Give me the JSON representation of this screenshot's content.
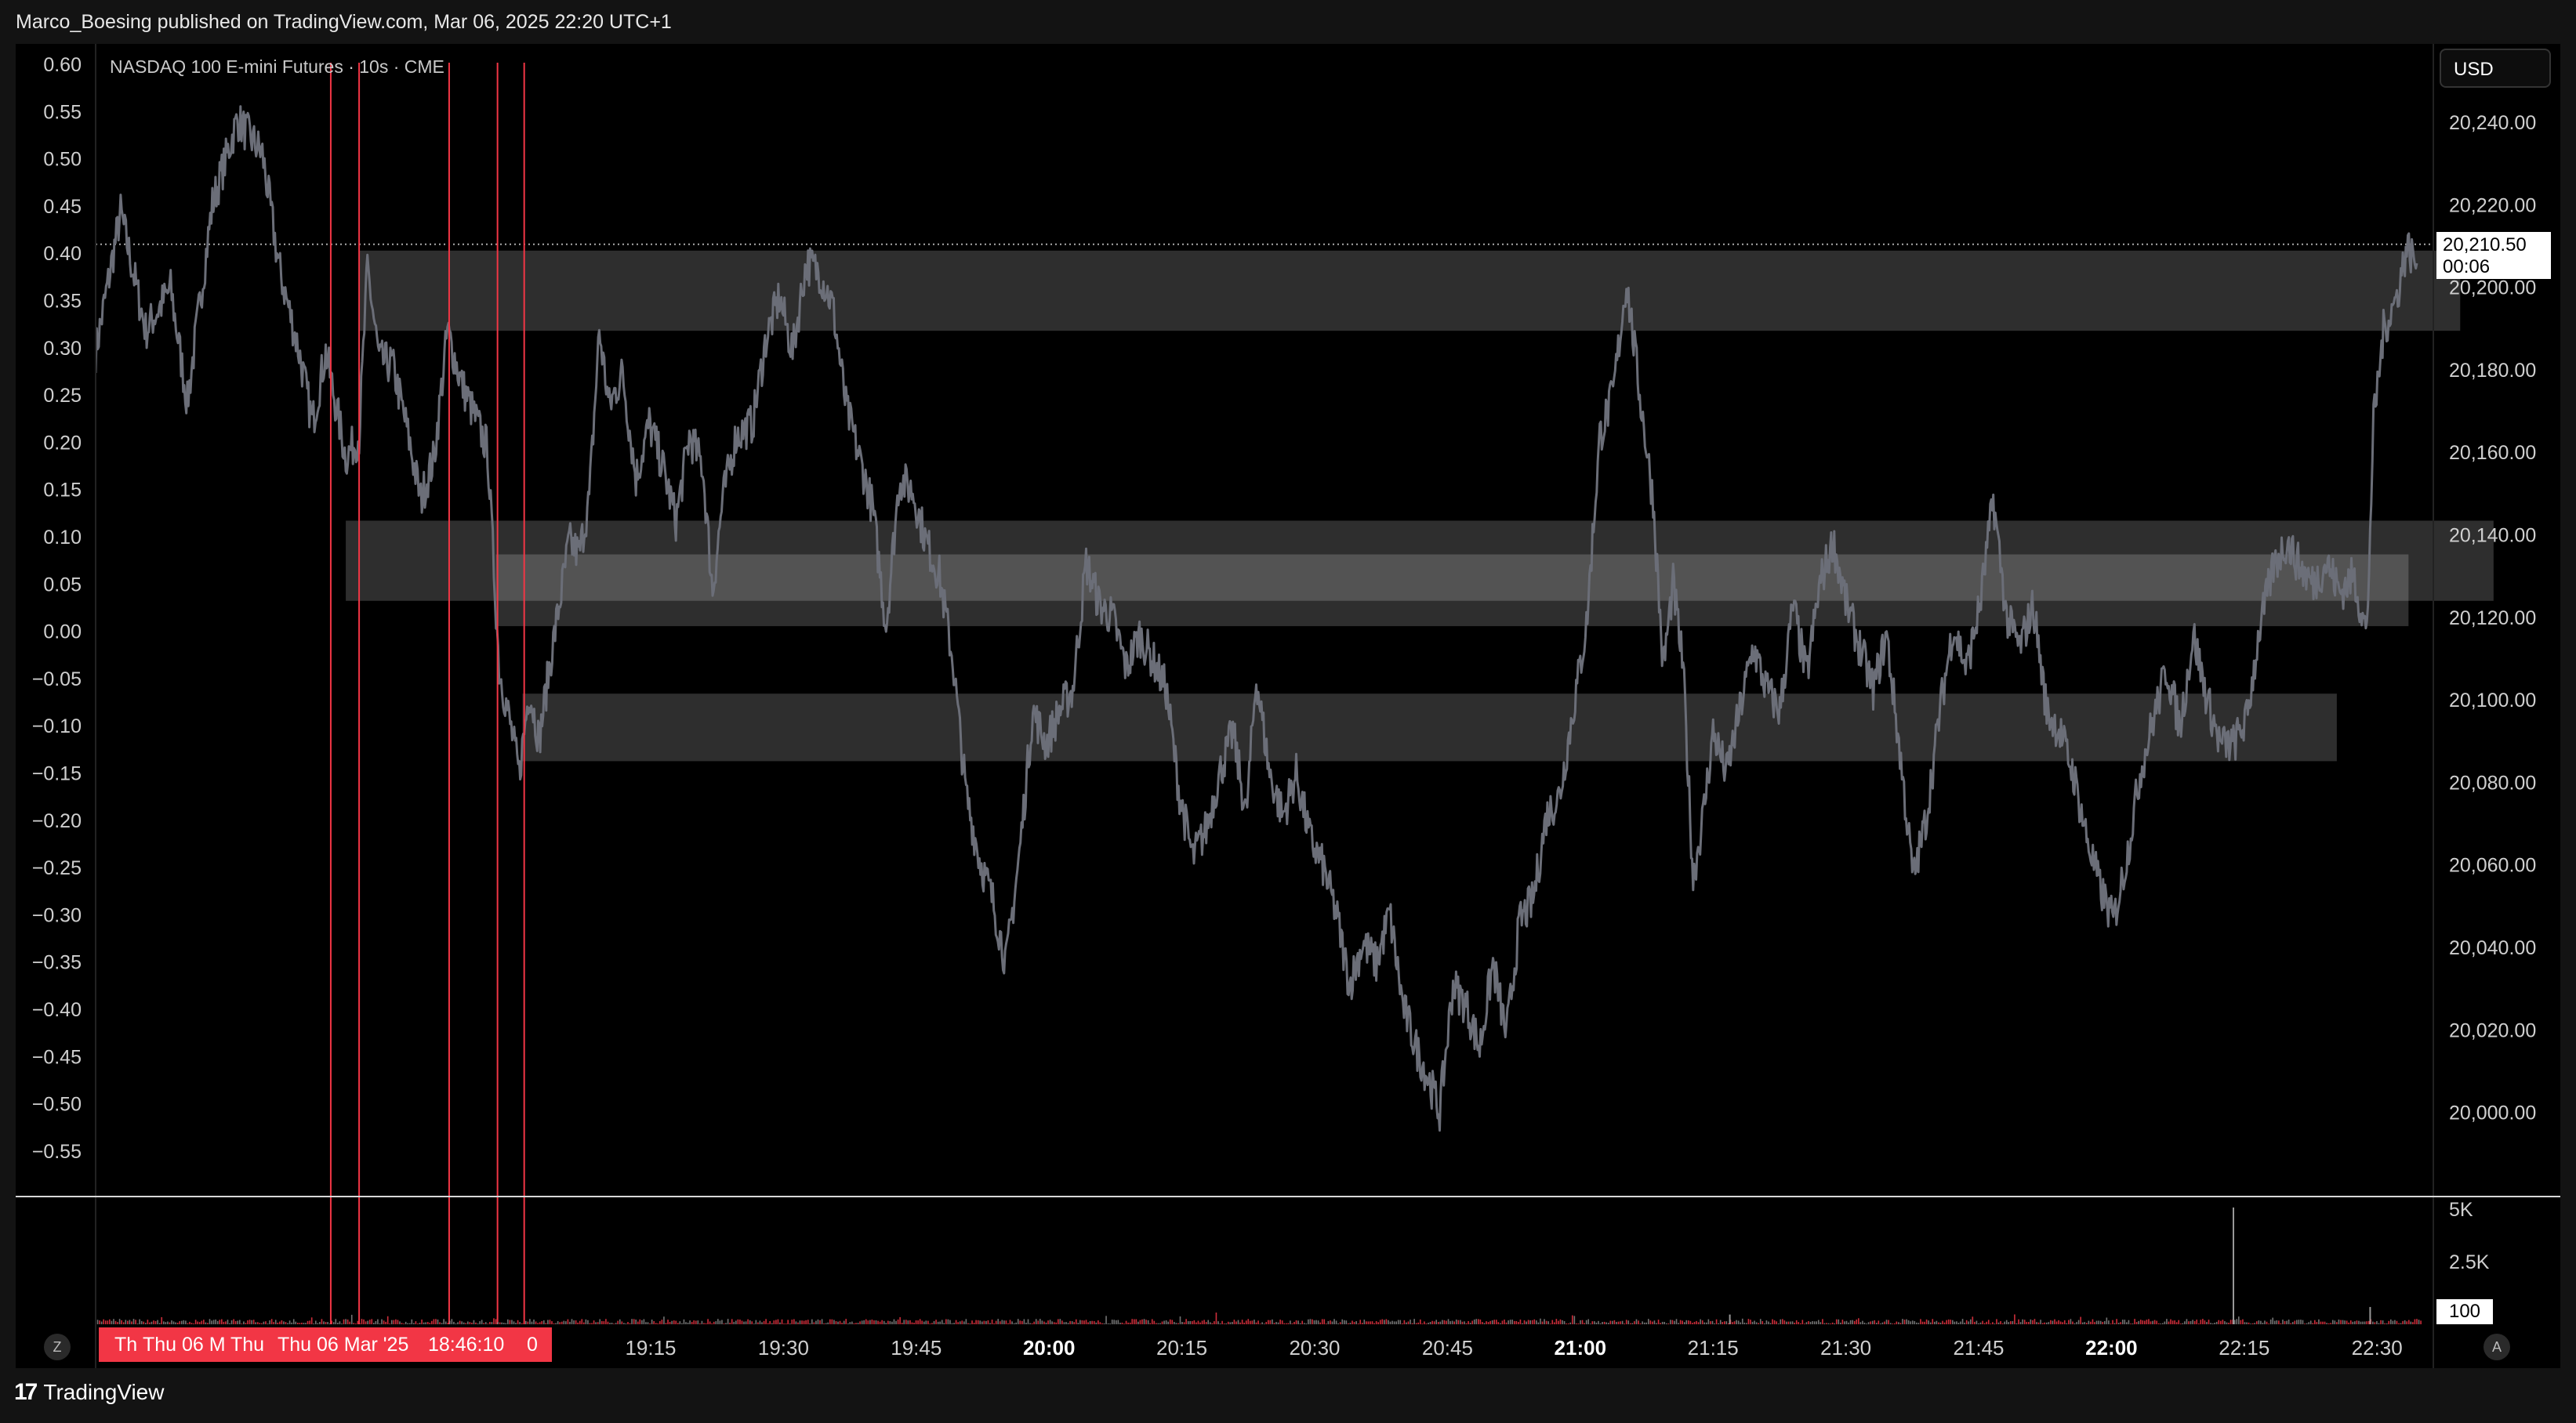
{
  "header": {
    "publish_line": "Marco_Boesing published on TradingView.com, Mar 06, 2025 22:20 UTC+1"
  },
  "legend": {
    "symbol_line": "NASDAQ 100 E-mini Futures · 10s · CME"
  },
  "currency": {
    "label": "USD"
  },
  "last_price": {
    "value": "20,210.50",
    "countdown": "00:06"
  },
  "volume_last": {
    "value": "100"
  },
  "time_selection": {
    "labels": [
      "Th",
      "Thu 06 M",
      "Thu",
      "Thu 06 Mar '25",
      "18:46:10",
      "0"
    ]
  },
  "footer": {
    "brand_name": "TradingView",
    "left_button": "Z",
    "right_button": "A"
  },
  "colors": {
    "candle": "#6b6e78",
    "zone": "#3a3a3a",
    "marker": "#f23645",
    "background": "#000000"
  },
  "chart_data": [
    {
      "type": "line",
      "series": [
        {
          "values": [
            [
              0,
              20185
            ],
            [
              15,
              20218
            ],
            [
              30,
              20190
            ],
            [
              45,
              20200
            ],
            [
              55,
              20173
            ],
            [
              70,
              20220
            ],
            [
              85,
              20240
            ],
            [
              100,
              20232
            ],
            [
              110,
              20205
            ],
            [
              122,
              20185
            ],
            [
              130,
              20168
            ],
            [
              138,
              20185
            ],
            [
              150,
              20160
            ],
            [
              158,
              20165
            ],
            [
              163,
              20205
            ],
            [
              170,
              20183
            ],
            [
              178,
              20182
            ],
            [
              186,
              20168
            ],
            [
              195,
              20150
            ],
            [
              203,
              20160
            ],
            [
              211,
              20190
            ],
            [
              219,
              20178
            ],
            [
              227,
              20170
            ],
            [
              235,
              20162
            ],
            [
              242,
              20110
            ],
            [
              248,
              20098
            ],
            [
              254,
              20085
            ],
            [
              260,
              20105
            ],
            [
              266,
              20093
            ],
            [
              272,
              20110
            ],
            [
              278,
              20125
            ],
            [
              284,
              20140
            ],
            [
              290,
              20137
            ],
            [
              296,
              20150
            ],
            [
              302,
              20190
            ],
            [
              308,
              20172
            ],
            [
              316,
              20180
            ],
            [
              324,
              20155
            ],
            [
              332,
              20168
            ],
            [
              340,
              20158
            ],
            [
              348,
              20145
            ],
            [
              356,
              20165
            ],
            [
              364,
              20158
            ],
            [
              370,
              20128
            ],
            [
              376,
              20150
            ],
            [
              384,
              20165
            ],
            [
              394,
              20168
            ],
            [
              402,
              20188
            ],
            [
              410,
              20198
            ],
            [
              418,
              20185
            ],
            [
              426,
              20206
            ],
            [
              434,
              20204
            ],
            [
              442,
              20196
            ],
            [
              450,
              20172
            ],
            [
              458,
              20160
            ],
            [
              466,
              20148
            ],
            [
              474,
              20120
            ],
            [
              482,
              20155
            ],
            [
              490,
              20152
            ],
            [
              498,
              20140
            ],
            [
              506,
              20132
            ],
            [
              514,
              20112
            ],
            [
              522,
              20080
            ],
            [
              530,
              20065
            ],
            [
              538,
              20055
            ],
            [
              546,
              20040
            ],
            [
              554,
              20066
            ],
            [
              562,
              20100
            ],
            [
              570,
              20092
            ],
            [
              578,
              20100
            ],
            [
              586,
              20105
            ],
            [
              594,
              20135
            ],
            [
              602,
              20125
            ],
            [
              610,
              20122
            ],
            [
              618,
              20110
            ],
            [
              626,
              20118
            ],
            [
              634,
              20112
            ],
            [
              642,
              20105
            ],
            [
              650,
              20080
            ],
            [
              658,
              20065
            ],
            [
              666,
              20072
            ],
            [
              674,
              20085
            ],
            [
              682,
              20095
            ],
            [
              690,
              20075
            ],
            [
              696,
              20108
            ],
            [
              704,
              20085
            ],
            [
              712,
              20075
            ],
            [
              720,
              20085
            ],
            [
              728,
              20070
            ],
            [
              736,
              20063
            ],
            [
              744,
              20052
            ],
            [
              752,
              20035
            ],
            [
              760,
              20045
            ],
            [
              768,
              20040
            ],
            [
              776,
              20052
            ],
            [
              784,
              20030
            ],
            [
              792,
              20020
            ],
            [
              800,
              20012
            ],
            [
              806,
              20005
            ],
            [
              814,
              20035
            ],
            [
              822,
              20030
            ],
            [
              830,
              20020
            ],
            [
              838,
              20040
            ],
            [
              846,
              20023
            ],
            [
              854,
              20050
            ],
            [
              862,
              20055
            ],
            [
              870,
              20075
            ],
            [
              878,
              20080
            ],
            [
              886,
              20100
            ],
            [
              894,
              20120
            ],
            [
              902,
              20165
            ],
            [
              910,
              20175
            ],
            [
              918,
              20202
            ],
            [
              926,
              20175
            ],
            [
              934,
              20150
            ],
            [
              940,
              20110
            ],
            [
              946,
              20130
            ],
            [
              952,
              20110
            ],
            [
              958,
              20060
            ],
            [
              964,
              20075
            ],
            [
              970,
              20095
            ],
            [
              978,
              20085
            ],
            [
              986,
              20100
            ],
            [
              994,
              20115
            ],
            [
              1002,
              20105
            ],
            [
              1010,
              20100
            ],
            [
              1018,
              20125
            ],
            [
              1026,
              20108
            ],
            [
              1034,
              20130
            ],
            [
              1042,
              20140
            ],
            [
              1050,
              20125
            ],
            [
              1058,
              20115
            ],
            [
              1066,
              20105
            ],
            [
              1074,
              20118
            ],
            [
              1082,
              20090
            ],
            [
              1090,
              20060
            ],
            [
              1098,
              20075
            ],
            [
              1106,
              20100
            ],
            [
              1114,
              20120
            ],
            [
              1122,
              20110
            ],
            [
              1130,
              20125
            ],
            [
              1138,
              20150
            ],
            [
              1146,
              20122
            ],
            [
              1154,
              20115
            ],
            [
              1162,
              20125
            ],
            [
              1170,
              20100
            ],
            [
              1178,
              20095
            ],
            [
              1186,
              20085
            ],
            [
              1194,
              20070
            ],
            [
              1202,
              20058
            ],
            [
              1210,
              20050
            ],
            [
              1218,
              20065
            ],
            [
              1226,
              20085
            ],
            [
              1234,
              20098
            ],
            [
              1242,
              20110
            ],
            [
              1250,
              20096
            ],
            [
              1258,
              20118
            ],
            [
              1266,
              20103
            ],
            [
              1274,
              20092
            ],
            [
              1282,
              20092
            ],
            [
              1290,
              20098
            ],
            [
              1298,
              20120
            ],
            [
              1306,
              20134
            ],
            [
              1314,
              20140
            ],
            [
              1322,
              20134
            ],
            [
              1330,
              20130
            ],
            [
              1338,
              20135
            ],
            [
              1346,
              20128
            ],
            [
              1354,
              20132
            ],
            [
              1362,
              20118
            ],
            [
              1366,
              20168
            ],
            [
              1372,
              20190
            ],
            [
              1380,
              20198
            ],
            [
              1386,
              20210
            ],
            [
              1392,
              20206
            ]
          ]
        }
      ],
      "x_ticks": [
        "19:15",
        "19:30",
        "19:45",
        "20:00",
        "20:15",
        "20:30",
        "20:45",
        "21:00",
        "21:15",
        "21:30",
        "21:45",
        "22:00",
        "22:15",
        "22:30"
      ],
      "x_ticks_bold": [
        "20:00",
        "21:00",
        "22:00"
      ],
      "y_ticks_right": [
        "20,240.00",
        "20,220.00",
        "20,200.00",
        "20,180.00",
        "20,160.00",
        "20,140.00",
        "20,120.00",
        "20,100.00",
        "20,080.00",
        "20,060.00",
        "20,040.00",
        "20,020.00",
        "20,000.00"
      ],
      "y_ticks_left": [
        "0.60",
        "0.55",
        "0.50",
        "0.45",
        "0.40",
        "0.35",
        "0.30",
        "0.25",
        "0.20",
        "0.15",
        "0.10",
        "0.05",
        "0.00",
        "−0.05",
        "−0.10",
        "−0.15",
        "−0.20",
        "−0.25",
        "−0.30",
        "−0.35",
        "−0.40",
        "−0.45",
        "−0.50",
        "−0.55"
      ],
      "ylim": [
        19985,
        20258
      ],
      "last_price_line": 20210.5,
      "zones": [
        {
          "x_start": 158,
          "x_end": 1418,
          "y_low": 20190,
          "y_high": 20209
        },
        {
          "x_start": 150,
          "x_end": 1438,
          "y_low": 20126,
          "y_high": 20145
        },
        {
          "x_start": 240,
          "x_end": 1387,
          "y_low": 20120,
          "y_high": 20137
        },
        {
          "x_start": 256,
          "x_end": 1344,
          "y_low": 20088,
          "y_high": 20104
        }
      ],
      "markers_x": [
        141,
        158,
        212,
        241,
        257
      ]
    },
    {
      "type": "bar",
      "name": "Volume",
      "y_ticks": [
        "5K",
        "2.5K"
      ],
      "ylim": [
        0,
        5800
      ],
      "spikes": [
        [
          1282,
          5400
        ],
        [
          1364,
          800
        ],
        [
          980,
          450
        ]
      ]
    }
  ]
}
